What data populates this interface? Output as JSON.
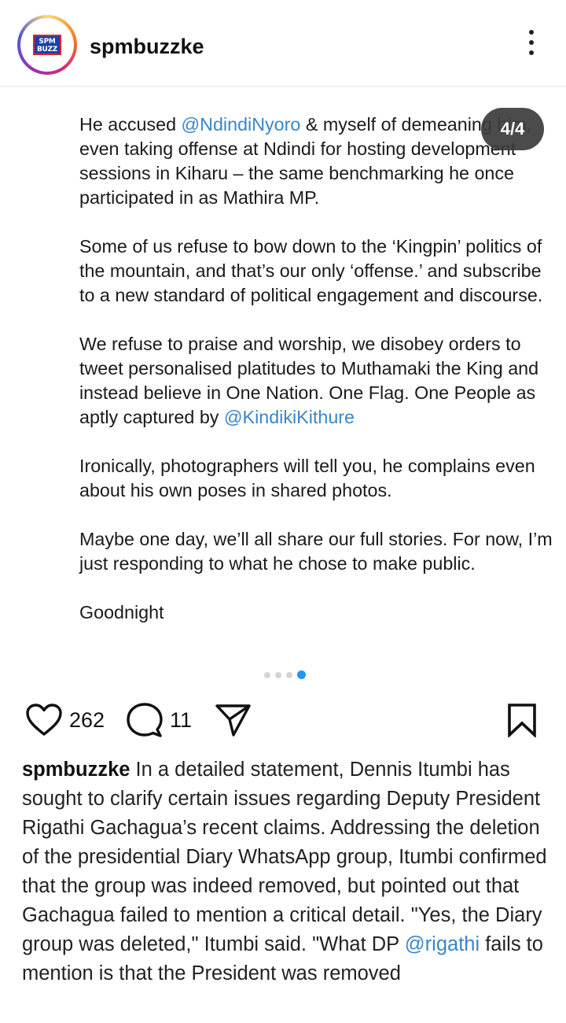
{
  "header": {
    "avatar_text": "SPM BUZZ",
    "username": "spmbuzzke",
    "more_icon": "more-vertical-icon"
  },
  "post": {
    "counter": "4/4",
    "paragraphs": {
      "p1": {
        "before": "He accused ",
        "mention": "@NdindiNyoro",
        "after": " & myself of demeaning him, even taking offense at Ndindi for hosting development sessions in Kiharu – the same benchmarking he once participated in as Mathira MP."
      },
      "p2": "Some of us refuse to bow down to the ‘Kingpin’ politics of the mountain, and that’s our only ‘offense.’ and subscribe to a new  standard of political engagement and discourse.",
      "p3": {
        "before": "We refuse to praise and worship,  we disobey orders to tweet personalised platitudes to Muthamaki the King and instead believe in One Nation. One Flag. One People as aptly captured by ",
        "mention": "@KindikiKithure"
      },
      "p4": "Ironically, photographers will tell you, he complains even about his own poses in shared photos.",
      "p5": "Maybe one day, we’ll all share our full stories. For now, I’m just responding to what he chose to make public.",
      "p6": "Goodnight"
    },
    "carousel": {
      "total": 4,
      "active_index": 3
    }
  },
  "actions": {
    "likes": "262",
    "comments": "11",
    "like_icon": "heart-icon",
    "comment_icon": "comment-icon",
    "share_icon": "send-icon",
    "save_icon": "bookmark-icon"
  },
  "caption": {
    "username": "spmbuzzke",
    "text_before": " In a detailed statement, Dennis Itumbi has sought to clarify certain issues regarding Deputy President Rigathi Gachagua’s recent claims. Addressing the deletion of the presidential Diary WhatsApp group, Itumbi confirmed that the group was indeed removed, but pointed out that Gachagua failed to mention a critical detail. \"Yes, the Diary group was deleted,\" Itumbi said. \"What DP ",
    "mention": "@rigathi",
    "text_after": " fails to mention is that the President was removed"
  },
  "colors": {
    "mention": "#3a86c8",
    "active_dot": "#2196f3",
    "counter_bg": "#3c3c3c"
  }
}
